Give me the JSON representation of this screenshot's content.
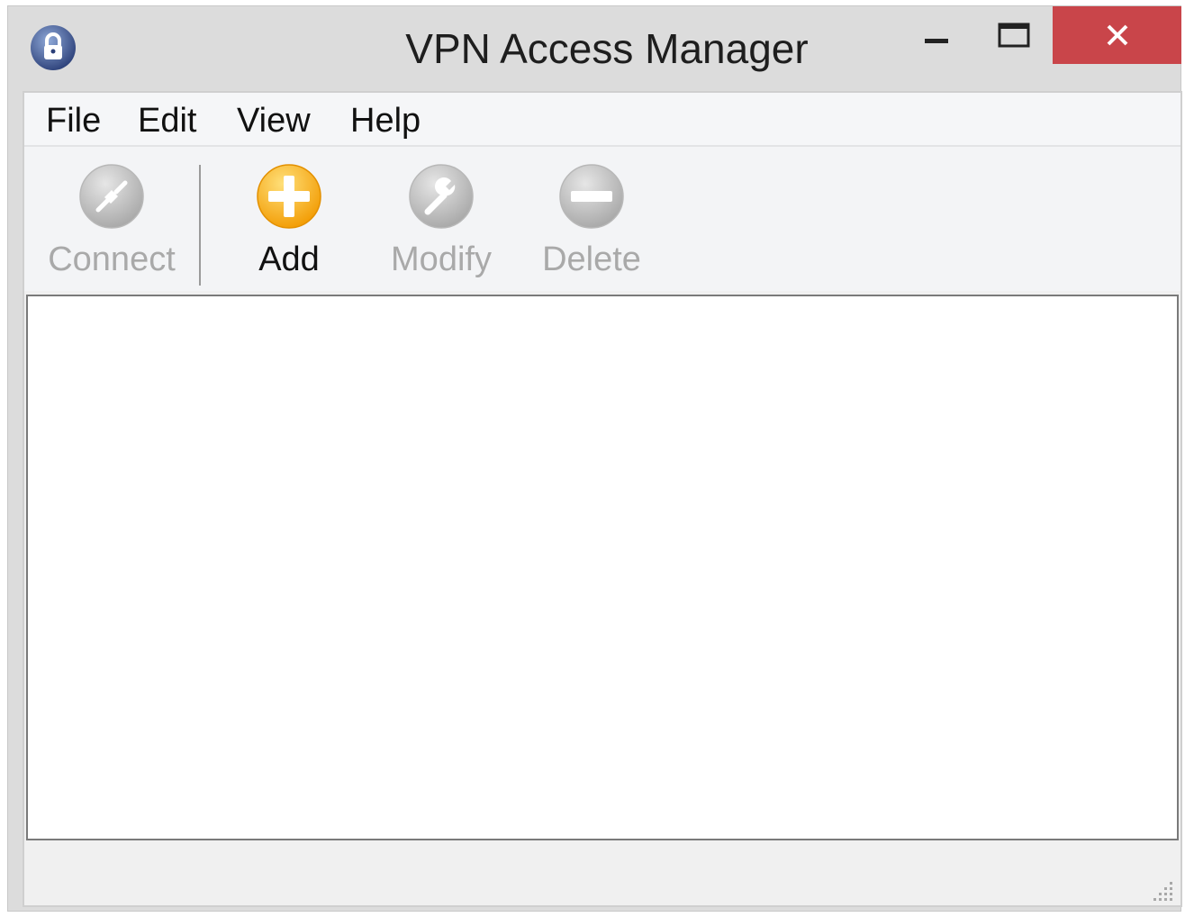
{
  "window": {
    "title": "VPN Access Manager",
    "app_icon": "padlock-icon",
    "controls": {
      "minimize": "minimize-icon",
      "maximize": "maximize-icon",
      "close": "close-icon",
      "close_color": "#c9454a"
    }
  },
  "menu": {
    "file": "File",
    "edit": "Edit",
    "view": "View",
    "help": "Help"
  },
  "toolbar": {
    "connect": {
      "label": "Connect",
      "icon": "connect-plug-icon",
      "enabled": false
    },
    "add": {
      "label": "Add",
      "icon": "add-plus-icon",
      "enabled": true,
      "color": "#f5a300"
    },
    "modify": {
      "label": "Modify",
      "icon": "wrench-icon",
      "enabled": false
    },
    "delete": {
      "label": "Delete",
      "icon": "minus-icon",
      "enabled": false
    }
  },
  "colors": {
    "disabled_text": "#a9a9a9",
    "enabled_text": "#111111"
  }
}
